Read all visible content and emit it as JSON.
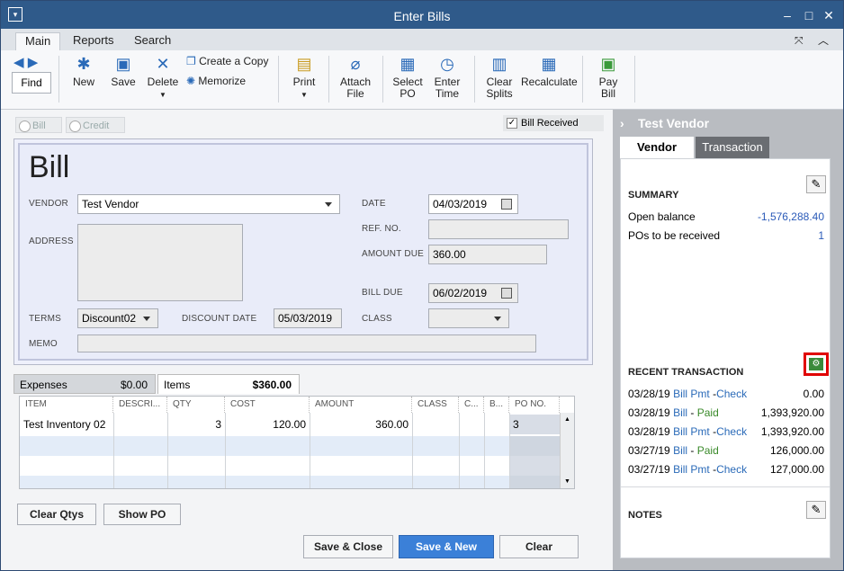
{
  "window": {
    "title": "Enter Bills"
  },
  "menu_tabs": [
    "Main",
    "Reports",
    "Search"
  ],
  "toolbar": {
    "find": "Find",
    "new": "New",
    "save": "Save",
    "delete": "Delete",
    "create_copy": "Create a Copy",
    "memorize": "Memorize",
    "print": "Print",
    "attach_file": [
      "Attach",
      "File"
    ],
    "select_po": [
      "Select",
      "PO"
    ],
    "enter_time": [
      "Enter",
      "Time"
    ],
    "clear_splits": [
      "Clear",
      "Splits"
    ],
    "recalculate": "Recalculate",
    "pay_bill": [
      "Pay",
      "Bill"
    ]
  },
  "type_options": {
    "bill": "Bill",
    "credit": "Credit"
  },
  "bill_received": "Bill Received",
  "form": {
    "heading": "Bill",
    "vendor_label": "VENDOR",
    "vendor": "Test Vendor",
    "address_label": "ADDRESS",
    "date_label": "DATE",
    "date": "04/03/2019",
    "ref_label": "REF. NO.",
    "ref": "",
    "amount_due_label": "AMOUNT DUE",
    "amount_due": "360.00",
    "bill_due_label": "BILL DUE",
    "bill_due": "06/02/2019",
    "terms_label": "TERMS",
    "terms": "Discount02",
    "discount_date_label": "DISCOUNT DATE",
    "discount_date": "05/03/2019",
    "class_label": "CLASS",
    "class": "",
    "memo_label": "MEMO",
    "memo": ""
  },
  "item_tabs": {
    "expenses": "Expenses",
    "expenses_amount": "$0.00",
    "items": "Items",
    "items_amount": "$360.00"
  },
  "grid": {
    "headers": [
      "ITEM",
      "DESCRI...",
      "QTY",
      "COST",
      "AMOUNT",
      "CLASS",
      "C...",
      "B...",
      "PO NO."
    ],
    "rows": [
      {
        "item": "Test Inventory 02",
        "desc": "",
        "qty": "3",
        "cost": "120.00",
        "amount": "360.00",
        "class": "",
        "c": "",
        "b": "",
        "po": "3"
      }
    ]
  },
  "buttons": {
    "clear_qtys": "Clear Qtys",
    "show_po": "Show PO",
    "save_close": "Save & Close",
    "save_new": "Save & New",
    "clear": "Clear"
  },
  "side": {
    "title": "Test Vendor",
    "tabs": [
      "Vendor",
      "Transaction"
    ],
    "summary_title": "SUMMARY",
    "summary": [
      {
        "label": "Open balance",
        "value": "-1,576,288.40"
      },
      {
        "label": "POs to be received",
        "value": "1"
      }
    ],
    "recent_title": "RECENT TRANSACTION",
    "recent": [
      {
        "date": "03/28/19",
        "a": "Bill Pmt",
        "sep": " -",
        "b": "Check",
        "amount": "0.00"
      },
      {
        "date": "03/28/19",
        "a": "Bill",
        "sep": " - ",
        "b": "Paid",
        "amount": "1,393,920.00"
      },
      {
        "date": "03/28/19",
        "a": "Bill Pmt",
        "sep": " -",
        "b": "Check",
        "amount": "1,393,920.00"
      },
      {
        "date": "03/27/19",
        "a": "Bill",
        "sep": " - ",
        "b": "Paid",
        "amount": "126,000.00"
      },
      {
        "date": "03/27/19",
        "a": "Bill Pmt",
        "sep": " -",
        "b": "Check",
        "amount": "127,000.00"
      }
    ],
    "notes_title": "NOTES"
  },
  "colors": {
    "titlebar": "#2f5a8a",
    "accent": "#3b80d8",
    "highlight": "#e00000"
  }
}
